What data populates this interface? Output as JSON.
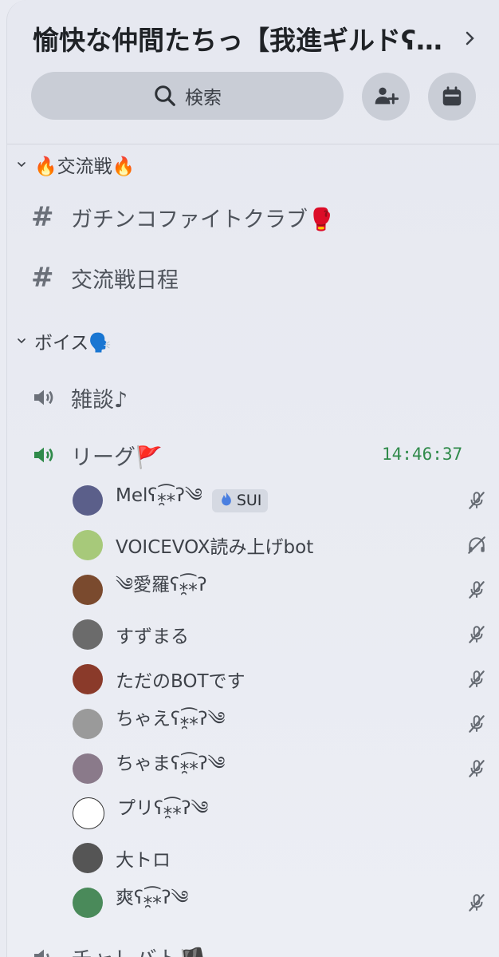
{
  "server": {
    "name": "愉快な仲間たちっ【我進ギルドʕ…"
  },
  "search": {
    "label": "検索"
  },
  "categories": [
    {
      "label": "🔥交流戦🔥"
    },
    {
      "label": "ボイス🗣️"
    }
  ],
  "text_channels": [
    {
      "label": "ガチンコファイトクラブ🥊"
    },
    {
      "label": "交流戦日程"
    }
  ],
  "voice_channels": [
    {
      "label": "雑談♪"
    },
    {
      "label": "リーグ🚩",
      "timer": "14:46:37"
    },
    {
      "label": "チャレバト🏴"
    }
  ],
  "members": [
    {
      "name": "Melʕ⁎̯͡⁎ʔ༄",
      "tag": "SUI",
      "status": "mic-muted",
      "avatar_color": "#5b5f8a"
    },
    {
      "name": "VOICEVOX読み上げbot",
      "status": "deafened",
      "avatar_color": "#a7c97a"
    },
    {
      "name": "༄愛羅ʕ⁎̯͡⁎ʔ",
      "status": "mic-muted",
      "avatar_color": "#7a4a2e"
    },
    {
      "name": "すずまる",
      "status": "mic-muted",
      "avatar_color": "#6b6b6b"
    },
    {
      "name": "ただのBOTです",
      "status": "mic-muted",
      "avatar_color": "#8a3a2a"
    },
    {
      "name": "ちゃえʕ⁎̯͡⁎ʔ༄",
      "status": "mic-muted",
      "avatar_color": "#9a9a9a"
    },
    {
      "name": "ちゃまʕ⁎̯͡⁎ʔ༄",
      "status": "mic-muted",
      "avatar_color": "#8a7a8a"
    },
    {
      "name": "プリʕ⁎̯͡⁎ʔ༄",
      "status": "none",
      "avatar_color": "#ffffff"
    },
    {
      "name": "大トロ",
      "status": "none",
      "avatar_color": "#555555"
    },
    {
      "name": "爽ʕ⁎̯͡⁎ʔ༄",
      "status": "mic-muted",
      "avatar_color": "#4a8a5a"
    }
  ],
  "colors": {
    "accent_green": "#2f8a4a",
    "background": "#e9ebf2"
  }
}
